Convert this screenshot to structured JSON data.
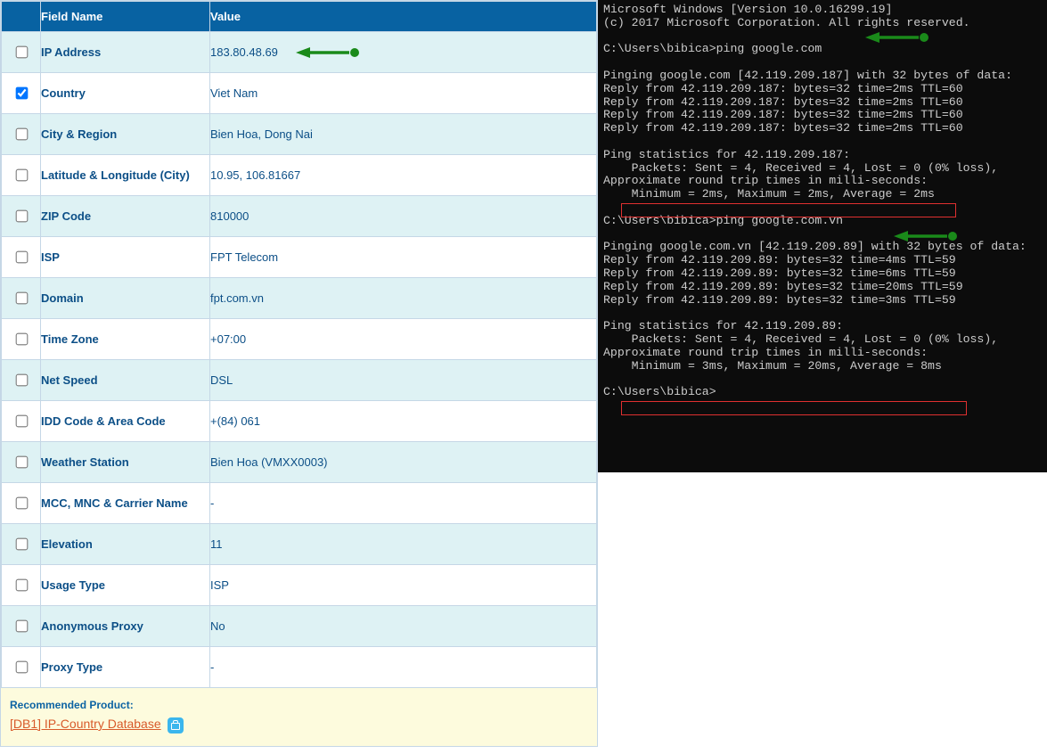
{
  "headers": {
    "field": "Field Name",
    "value": "Value"
  },
  "rows": [
    {
      "checked": false,
      "name": "IP Address",
      "value": "183.80.48.69",
      "arrow": true
    },
    {
      "checked": true,
      "name": "Country",
      "value": "Viet Nam"
    },
    {
      "checked": false,
      "name": "City & Region",
      "value": "Bien Hoa, Dong Nai"
    },
    {
      "checked": false,
      "name": "Latitude & Longitude (City)",
      "value": "10.95, 106.81667"
    },
    {
      "checked": false,
      "name": "ZIP Code",
      "value": "810000"
    },
    {
      "checked": false,
      "name": "ISP",
      "value": "FPT Telecom"
    },
    {
      "checked": false,
      "name": "Domain",
      "value": "fpt.com.vn"
    },
    {
      "checked": false,
      "name": "Time Zone",
      "value": "+07:00"
    },
    {
      "checked": false,
      "name": "Net Speed",
      "value": "DSL"
    },
    {
      "checked": false,
      "name": "IDD Code & Area Code",
      "value": "+(84) 061"
    },
    {
      "checked": false,
      "name": "Weather Station",
      "value": "Bien Hoa (VMXX0003)"
    },
    {
      "checked": false,
      "name": "MCC, MNC & Carrier Name",
      "value": "-"
    },
    {
      "checked": false,
      "name": "Elevation",
      "value": "11"
    },
    {
      "checked": false,
      "name": "Usage Type",
      "value": "ISP"
    },
    {
      "checked": false,
      "name": "Anonymous Proxy",
      "value": "No"
    },
    {
      "checked": false,
      "name": "Proxy Type",
      "value": "-"
    }
  ],
  "footer": {
    "recommended": "Recommended Product:",
    "link": "[DB1] IP-Country Database"
  },
  "terminal": {
    "lines": [
      "Microsoft Windows [Version 10.0.16299.19]",
      "(c) 2017 Microsoft Corporation. All rights reserved.",
      "",
      "C:\\Users\\bibica>ping google.com",
      "",
      "Pinging google.com [42.119.209.187] with 32 bytes of data:",
      "Reply from 42.119.209.187: bytes=32 time=2ms TTL=60",
      "Reply from 42.119.209.187: bytes=32 time=2ms TTL=60",
      "Reply from 42.119.209.187: bytes=32 time=2ms TTL=60",
      "Reply from 42.119.209.187: bytes=32 time=2ms TTL=60",
      "",
      "Ping statistics for 42.119.209.187:",
      "    Packets: Sent = 4, Received = 4, Lost = 0 (0% loss),",
      "Approximate round trip times in milli-seconds:",
      "    Minimum = 2ms, Maximum = 2ms, Average = 2ms",
      "",
      "C:\\Users\\bibica>ping google.com.vn",
      "",
      "Pinging google.com.vn [42.119.209.89] with 32 bytes of data:",
      "Reply from 42.119.209.89: bytes=32 time=4ms TTL=59",
      "Reply from 42.119.209.89: bytes=32 time=6ms TTL=59",
      "Reply from 42.119.209.89: bytes=32 time=20ms TTL=59",
      "Reply from 42.119.209.89: bytes=32 time=3ms TTL=59",
      "",
      "Ping statistics for 42.119.209.89:",
      "    Packets: Sent = 4, Received = 4, Lost = 0 (0% loss),",
      "Approximate round trip times in milli-seconds:",
      "    Minimum = 3ms, Maximum = 20ms, Average = 8ms",
      "",
      "C:\\Users\\bibica>"
    ]
  },
  "colors": {
    "arrow": "#1a8a1a"
  }
}
